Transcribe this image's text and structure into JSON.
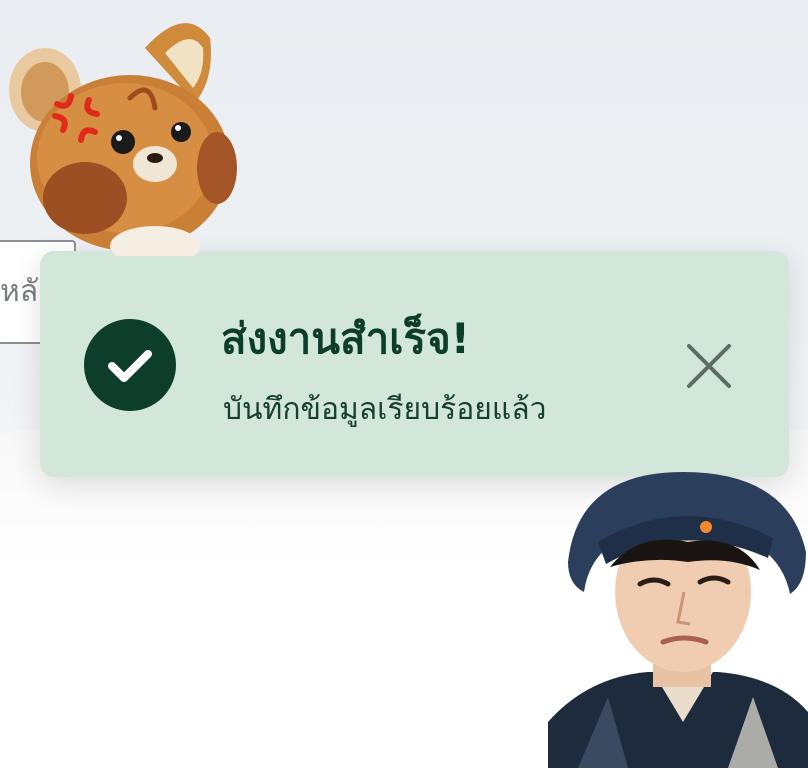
{
  "background": {
    "input_partial_text": "หลั"
  },
  "toast": {
    "title": "ส่งงานสำเร็จ!",
    "message": "บันทึกข้อมูลเรียบร้อยแล้ว",
    "status_icon": "check-circle-icon",
    "close_icon": "close-icon",
    "bg_color": "#d2e6d9",
    "accent_color": "#0d3d2b"
  },
  "stickers": {
    "top_left": "angry-plush-bear-sticker",
    "bottom_right": "person-bucket-hat-sticker"
  }
}
